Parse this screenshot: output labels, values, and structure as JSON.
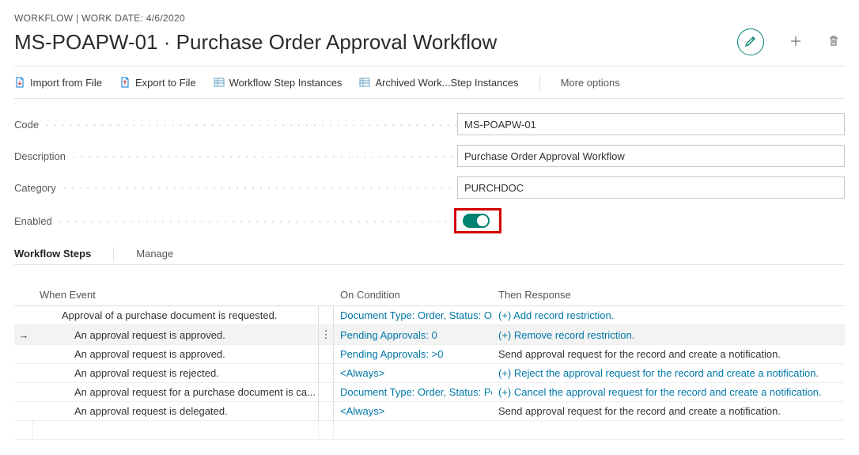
{
  "breadcrumb": "WORKFLOW | WORK DATE: 4/6/2020",
  "page_title": "MS-POAPW-01 · Purchase Order Approval Workflow",
  "toolbar": {
    "import": "Import from File",
    "export": "Export to File",
    "step_instances": "Workflow Step Instances",
    "archived": "Archived Work...Step Instances",
    "more": "More options"
  },
  "form": {
    "labels": {
      "code": "Code",
      "description": "Description",
      "category": "Category",
      "enabled": "Enabled"
    },
    "values": {
      "code": "MS-POAPW-01",
      "description": "Purchase Order Approval Workflow",
      "category": "PURCHDOC",
      "enabled": true
    }
  },
  "subtabs": {
    "steps": "Workflow Steps",
    "manage": "Manage"
  },
  "grid": {
    "headers": {
      "when": "When Event",
      "cond": "On Condition",
      "resp": "Then Response"
    },
    "rows": [
      {
        "indent": 1,
        "selected": false,
        "event": "Approval of a purchase document is requested.",
        "cond": "Document Type: Order, Status: Open, ...",
        "cond_link": true,
        "resp": "(+) Add record restriction.",
        "resp_link": true
      },
      {
        "indent": 2,
        "selected": true,
        "event": "An approval request is approved.",
        "cond": "Pending Approvals: 0",
        "cond_link": true,
        "resp": "(+) Remove record restriction.",
        "resp_link": true
      },
      {
        "indent": 2,
        "selected": false,
        "event": "An approval request is approved.",
        "cond": "Pending Approvals: >0",
        "cond_link": true,
        "resp": "Send approval request for the record and create a notification.",
        "resp_link": false
      },
      {
        "indent": 2,
        "selected": false,
        "event": "An approval request is rejected.",
        "cond": "<Always>",
        "cond_link": true,
        "resp": "(+) Reject the approval request for the record and create a notification.",
        "resp_link": true
      },
      {
        "indent": 2,
        "selected": false,
        "event": "An approval request for a purchase document is ca...",
        "cond": "Document Type: Order, Status: Pendin...",
        "cond_link": true,
        "resp": "(+) Cancel the approval request for the record and create a notification.",
        "resp_link": true
      },
      {
        "indent": 2,
        "selected": false,
        "event": "An approval request is delegated.",
        "cond": "<Always>",
        "cond_link": true,
        "resp": "Send approval request for the record and create a notification.",
        "resp_link": false
      }
    ]
  }
}
